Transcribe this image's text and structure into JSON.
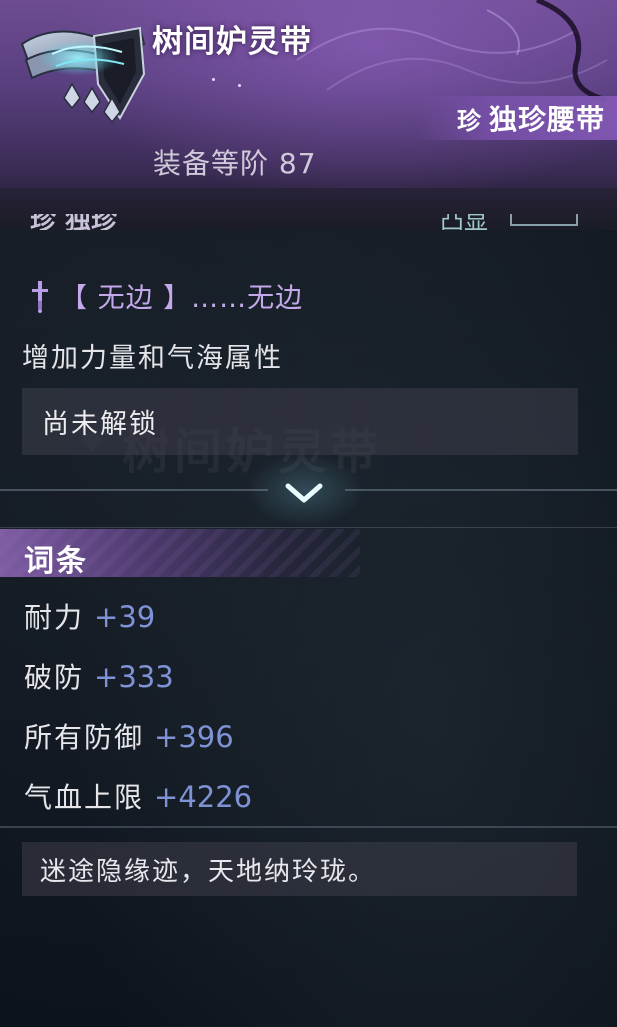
{
  "item": {
    "name": "树间妒灵带",
    "rarity_icon_char": "珍",
    "rarity_label": "独珍腰带",
    "equip_level_label": "装备等阶",
    "equip_level_value": "87"
  },
  "set_effect": {
    "icon": "sword-icon",
    "text": "【 无边 】……无边",
    "description": "增加力量和气海属性",
    "lock_status": "尚未解锁"
  },
  "attributes": {
    "title": "词条",
    "items": [
      {
        "name": "耐力",
        "value": "+39"
      },
      {
        "name": "破防",
        "value": "+333"
      },
      {
        "name": "所有防御",
        "value": "+396"
      },
      {
        "name": "气血上限",
        "value": "+4226"
      }
    ]
  },
  "flavor_text": "迷途隐缘迹，天地纳玲珑。",
  "colors": {
    "header_purple": "#5a4080",
    "set_effect_text": "#c3a8ea",
    "attr_value": "#7f92d6",
    "background": "#111822"
  }
}
